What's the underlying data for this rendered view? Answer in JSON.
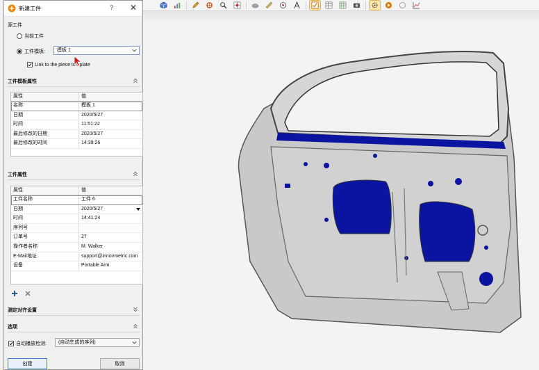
{
  "dialog": {
    "title": "新建工件",
    "help_label": "?",
    "close_label": "✕",
    "source_group_label": "源工件",
    "radio_current_label": "当前工件",
    "radio_template_label": "工件模板:",
    "template_combo_value": "模板 1",
    "link_checkbox_label": "Link to the piece template",
    "template_props": {
      "title": "工件模板属性",
      "col_property": "属性",
      "col_value": "值",
      "rows": [
        {
          "k": "名称",
          "v": "模板 1"
        },
        {
          "k": "日期",
          "v": "2020/5/27"
        },
        {
          "k": "时间",
          "v": "11:51:22"
        },
        {
          "k": "最后修改的日期",
          "v": "2020/5/27"
        },
        {
          "k": "最后修改的时间",
          "v": "14:39:26"
        }
      ]
    },
    "piece_props": {
      "title": "工件属性",
      "col_property": "属性",
      "col_value": "值",
      "rows": [
        {
          "k": "工件名称",
          "v": "工件 6"
        },
        {
          "k": "日期",
          "v": "2020/5/27"
        },
        {
          "k": "时间",
          "v": "14:41:24"
        },
        {
          "k": "序列号",
          "v": ""
        },
        {
          "k": "订单号",
          "v": "27"
        },
        {
          "k": "操作者名称",
          "v": "M. Walker"
        },
        {
          "k": "E-Mail地址",
          "v": "support@innovmetric.com"
        },
        {
          "k": "设备",
          "v": "Portable Arm"
        }
      ]
    },
    "align_section_title": "测定对齐设置",
    "options_section_title": "选项",
    "auto_check_label": "自动播放检测:",
    "auto_combo_value": "(自动生成的序列)",
    "create_button": "创建",
    "cancel_button": "取消"
  },
  "icons": {
    "toolbar": [
      "cube-icon",
      "chart-icon",
      "pen-icon",
      "tool-icon",
      "magnify-icon",
      "grid-icon",
      "cloud-icon",
      "ruler-icon",
      "target-icon",
      "text-icon",
      "checkbox-icon",
      "table-icon",
      "spreadsheet-icon",
      "camera-icon",
      "play-icon",
      "stop-icon",
      "settings-icon",
      "graph-icon"
    ]
  },
  "colors": {
    "accent_blue": "#0a14a0",
    "door_gray": "#c8c8c8",
    "dialog_bg": "#f0f0f0"
  }
}
